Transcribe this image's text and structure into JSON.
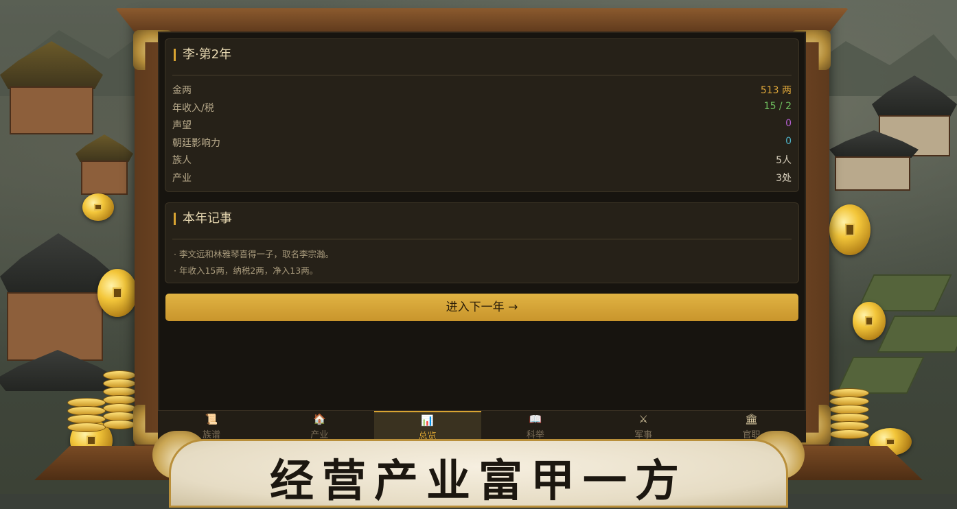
{
  "status": {
    "title": "李·第2年",
    "rows": [
      {
        "label": "金两",
        "value": "513 两",
        "color": "#e0a83a"
      },
      {
        "label": "年收入/税",
        "value": "15 / 2",
        "color": "#6fbf5f"
      },
      {
        "label": "声望",
        "value": "0",
        "color": "#b45fd0"
      },
      {
        "label": "朝廷影响力",
        "value": "0",
        "color": "#4fb3c8"
      },
      {
        "label": "族人",
        "value": "5人",
        "color": "#d9d0bd"
      },
      {
        "label": "产业",
        "value": "3处",
        "color": "#d9d0bd"
      }
    ]
  },
  "events": {
    "title": "本年记事",
    "items": [
      "· 李文远和林雅琴喜得一子，取名李宗瀚。",
      "· 年收入15两，纳税2两，净入13两。"
    ]
  },
  "next_button": "进入下一年 →",
  "tabs": [
    {
      "icon": "📜",
      "icon_name": "scroll-icon",
      "label": "族谱",
      "active": false
    },
    {
      "icon": "🏠",
      "icon_name": "house-icon",
      "label": "产业",
      "active": false
    },
    {
      "icon": "📊",
      "icon_name": "chart-icon",
      "label": "总览",
      "active": true
    },
    {
      "icon": "📖",
      "icon_name": "book-icon",
      "label": "科举",
      "active": false
    },
    {
      "icon": "⚔",
      "icon_name": "swords-icon",
      "label": "军事",
      "active": false
    },
    {
      "icon": "🏛",
      "icon_name": "court-icon",
      "label": "官职",
      "active": false
    }
  ],
  "banner": "经营产业富甲一方",
  "colors": {
    "accent": "#d9a432",
    "panel": "#17140f",
    "card": "#262118"
  }
}
